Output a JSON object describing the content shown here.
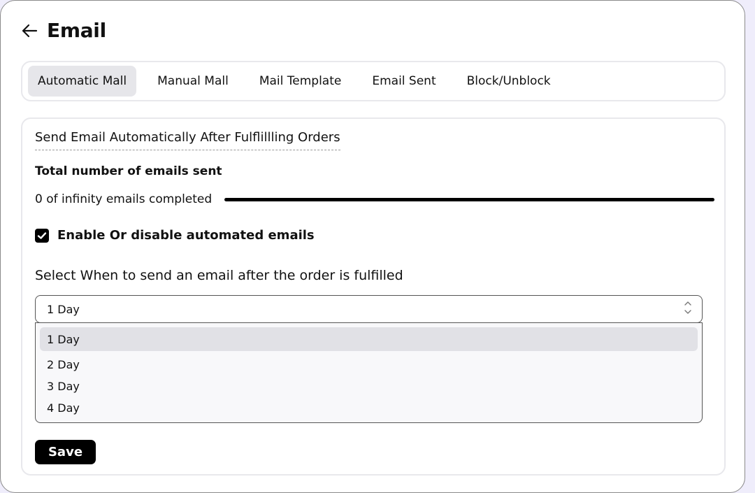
{
  "header": {
    "back_icon": "arrow-left-icon",
    "title": "Email"
  },
  "tabs": [
    {
      "label": "Automatic Mall",
      "active": true
    },
    {
      "label": "Manual Mall",
      "active": false
    },
    {
      "label": "Mail Template",
      "active": false
    },
    {
      "label": "Email Sent",
      "active": false
    },
    {
      "label": "Block/Unblock",
      "active": false
    }
  ],
  "panel": {
    "section_title": "Send Email Automatically After Fulflillling Orders",
    "total_label": "Total number of emails sent",
    "progress": {
      "text": "0 of infinity emails completed",
      "value": 0
    },
    "automation_checkbox": {
      "label": "Enable Or disable automated emails",
      "checked": true
    },
    "schedule": {
      "label": "Select When to send an email after the order is fulfilled",
      "selected": "1 Day",
      "options": [
        "1 Day",
        "2 Day",
        "3 Day",
        "4 Day"
      ]
    },
    "save_label": "Save"
  },
  "colors": {
    "accent": "#000000",
    "backdrop": "#efedfb",
    "active_tab": "#e6e6ea"
  }
}
